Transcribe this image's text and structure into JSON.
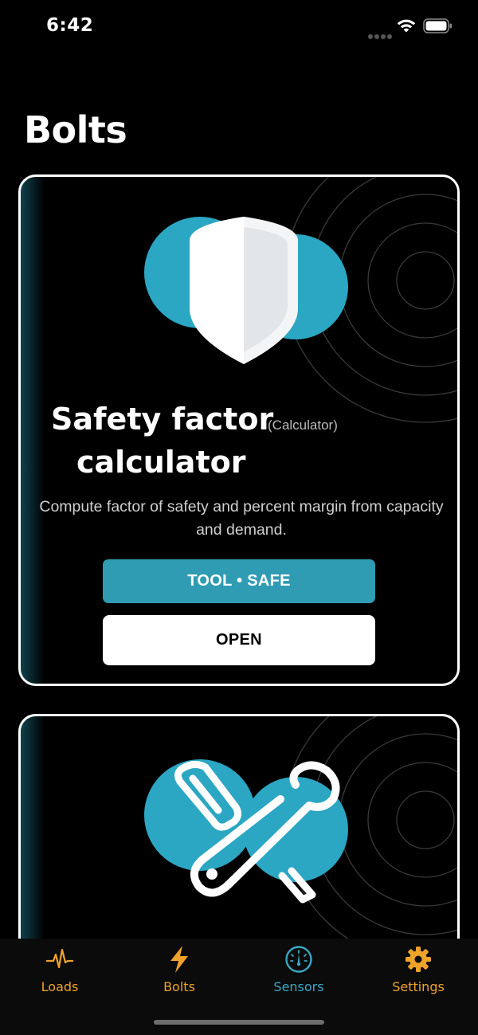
{
  "status_bar": {
    "time": "6:42"
  },
  "page": {
    "title": "Bolts"
  },
  "cards": [
    {
      "title_line1": "Safety factor",
      "title_line2": "calculator",
      "tag": "(Calculator)",
      "description": "Compute factor of safety and percent margin from capacity and demand.",
      "badge": "TOOL • SAFE",
      "action": "OPEN",
      "icon": "shield-icon"
    },
    {
      "icon": "tools-icon"
    }
  ],
  "tab_bar": {
    "items": [
      {
        "label": "Loads",
        "icon": "pulse-icon",
        "active": false
      },
      {
        "label": "Bolts",
        "icon": "lightning-icon",
        "active": false
      },
      {
        "label": "Sensors",
        "icon": "gauge-icon",
        "active": true
      },
      {
        "label": "Settings",
        "icon": "gear-icon",
        "active": false
      }
    ]
  },
  "colors": {
    "accent": "#2f9cb3",
    "illustration_circle": "#2ba6c3",
    "tab_inactive": "#f0a32a",
    "tab_active": "#3aa8c4"
  }
}
